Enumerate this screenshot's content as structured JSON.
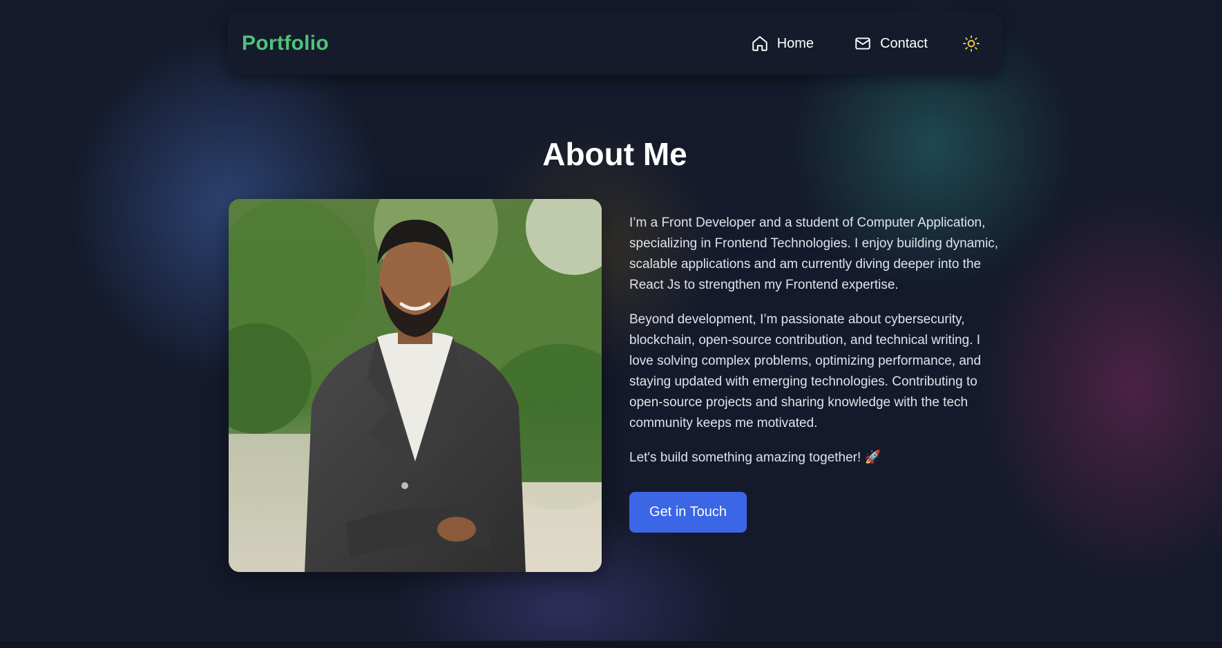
{
  "navbar": {
    "brand": "Portfolio",
    "links": [
      {
        "label": "Home",
        "icon": "home-icon"
      },
      {
        "label": "Contact",
        "icon": "mail-icon"
      }
    ],
    "theme_toggle_icon": "sun-icon"
  },
  "about": {
    "title": "About Me",
    "paragraphs": [
      "I’m a Front Developer and a student of Computer Application, specializing in Frontend Technologies. I enjoy building dynamic, scalable applications and am currently diving deeper into the React Js to strengthen my Frontend expertise.",
      "Beyond development, I’m passionate about cybersecurity, blockchain, open-source contribution, and technical writing. I love solving complex problems, optimizing performance, and staying updated with emerging technologies. Contributing to open-source projects and sharing knowledge with the tech community keeps me motivated.",
      "Let's build something amazing together! 🚀"
    ],
    "cta_label": "Get in Touch"
  },
  "colors": {
    "brand": "#4fc27a",
    "accent": "#3b66e6",
    "sun": "#f2c94c",
    "background": "#141a2b"
  }
}
